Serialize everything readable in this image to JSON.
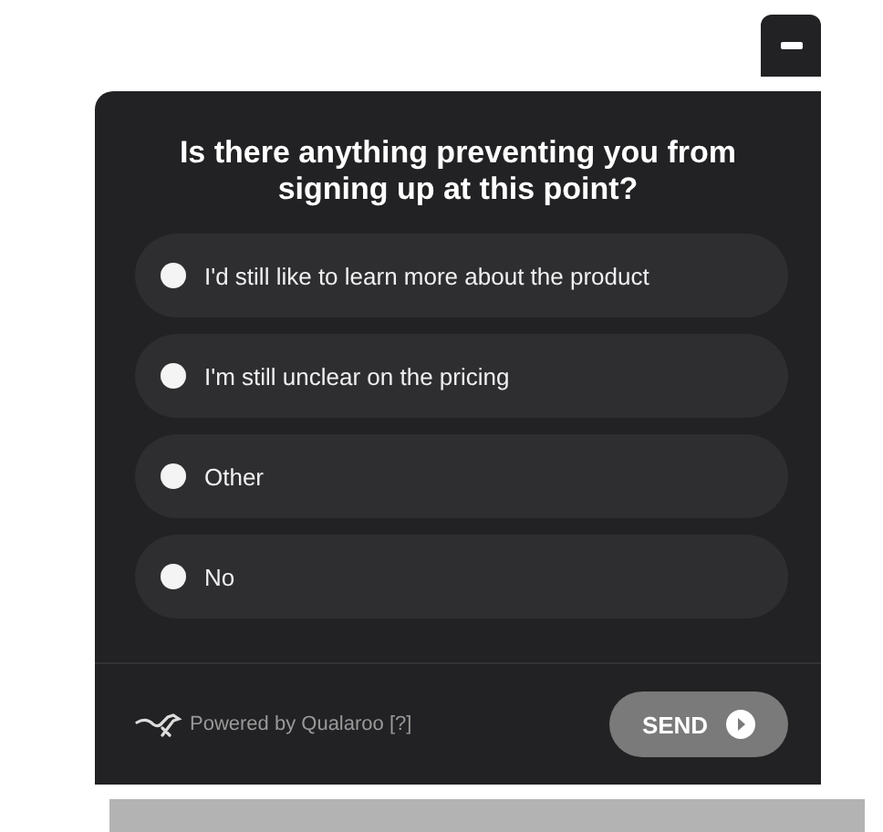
{
  "survey": {
    "question": "Is there anything preventing you from signing up at this point?",
    "options": [
      {
        "label": "I'd still like to learn more about the product",
        "selected": false
      },
      {
        "label": "I'm still unclear on the pricing",
        "selected": false
      },
      {
        "label": "Other",
        "selected": false
      },
      {
        "label": "No",
        "selected": false
      }
    ],
    "footer": {
      "powered_by": "Powered by Qualaroo [?]",
      "send_button": "SEND"
    }
  }
}
